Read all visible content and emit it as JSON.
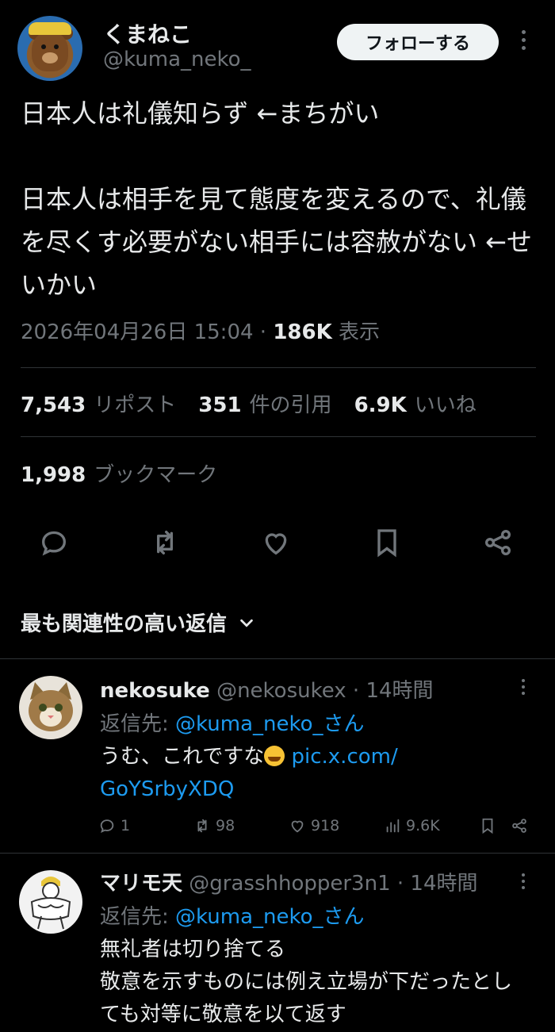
{
  "tweet": {
    "display_name": "くまねこ",
    "handle": "@kuma_neko_",
    "follow_label": "フォローする",
    "text": "日本人は礼儀知らず ←まちがい\n\n日本人は相手を見て態度を変えるので、礼儀を尽くす必要がない相手には容赦がない ←せいかい",
    "date": "2026年04月26日 15:04",
    "views": "186K",
    "views_label": "表示",
    "reposts": "7,543",
    "reposts_label": "リポスト",
    "quotes": "351",
    "quotes_label": "件の引用",
    "likes": "6.9K",
    "likes_label": "いいね",
    "bookmarks": "1,998",
    "bookmarks_label": "ブックマーク"
  },
  "sort_label": "最も関連性の高い返信",
  "icons": [
    "comment-icon",
    "repost-icon",
    "heart-icon",
    "bookmark-icon",
    "share-icon",
    "chevron-down-icon",
    "more-icon",
    "views-icon"
  ],
  "colors": {
    "background": "#000000",
    "text": "#e7e9ea",
    "muted": "#71767b",
    "link": "#1d9bf0",
    "divider": "#2f3336"
  },
  "replies": [
    {
      "name": "nekosuke",
      "handle": "@nekosukex",
      "time": "14時間",
      "reply_to_prefix": "返信先:",
      "reply_to": "@kuma_neko_さん",
      "text": "うむ、これですな",
      "link_text": "pic.x.com/\nGoYSrbyXDQ",
      "comments": "1",
      "reposts": "98",
      "likes": "918",
      "views": "9.6K"
    },
    {
      "name": "マリモ天",
      "handle": "@grasshhopper3n1",
      "time": "14時間",
      "reply_to_prefix": "返信先:",
      "reply_to": "@kuma_neko_さん",
      "text": "無礼者は切り捨てる\n敬意を示すものには例え立場が下だったとしても対等に敬意を以て返す"
    }
  ]
}
